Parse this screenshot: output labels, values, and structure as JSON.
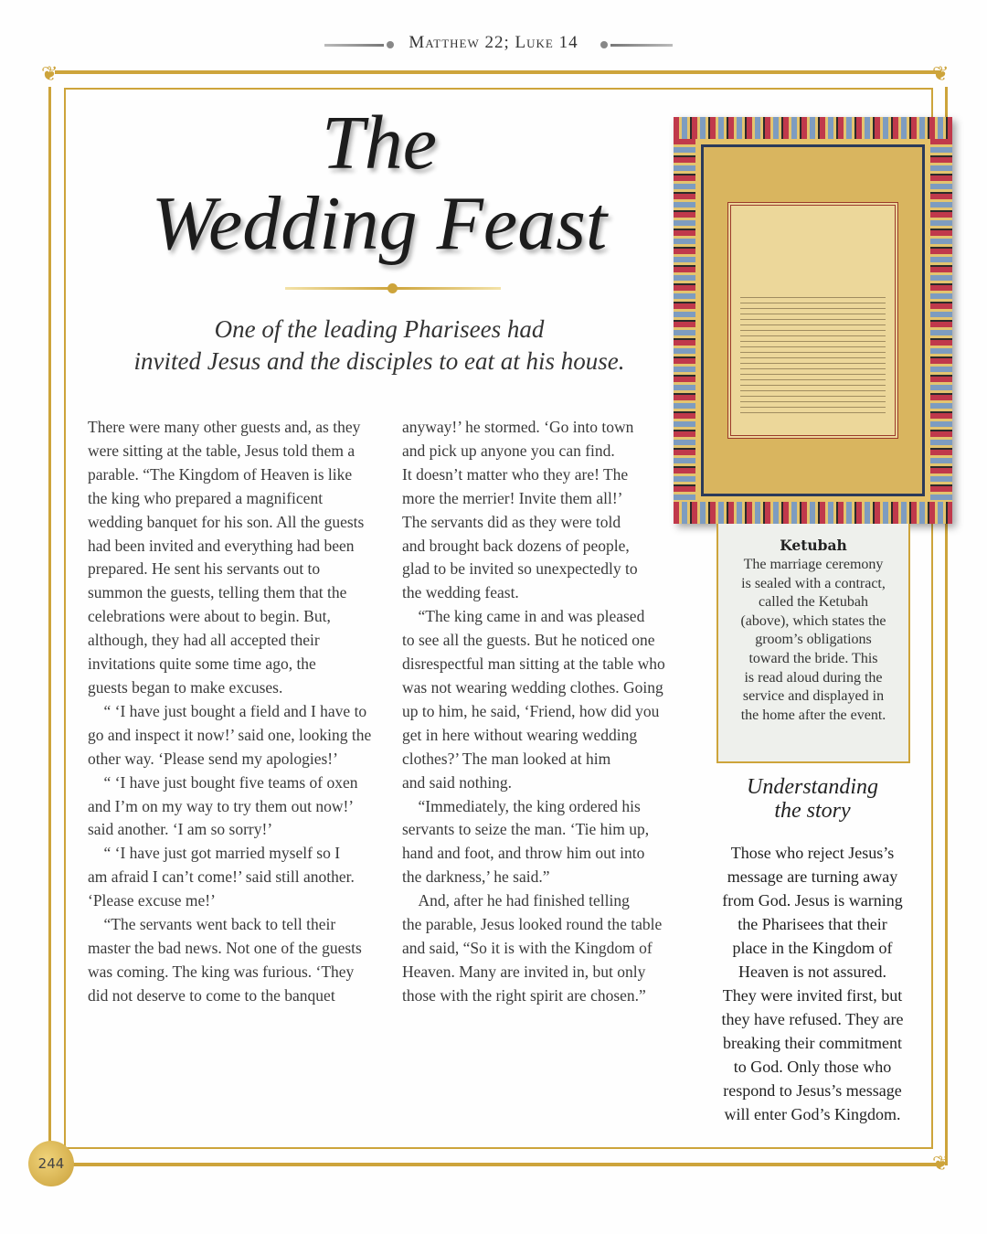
{
  "header": {
    "running_head": "Matthew 22; Luke 14"
  },
  "title": {
    "line1": "The",
    "line2": "Wedding Feast"
  },
  "intro": {
    "line1": "One of the leading Pharisees had",
    "line2": "invited Jesus and the disciples to eat at his house."
  },
  "story": {
    "col1": [
      "There were many other guests and, as they",
      "were sitting at the table, Jesus told them a",
      "parable. “The Kingdom of Heaven is like",
      "the king who prepared a magnificent",
      "wedding banquet for his son. All the guests",
      "had been invited and everything had been",
      "prepared. He sent his servants out to",
      "summon the guests, telling them that the",
      "celebrations were about to begin. But,",
      "although, they had all accepted their",
      "invitations quite some time ago, the",
      "guests began to make excuses.",
      "    “ ‘I have just bought a field and I have to",
      "go and inspect it now!’ said one, looking the",
      "other way. ‘Please send my apologies!’",
      "    “ ‘I have just bought five teams of oxen",
      "and I’m on my way to try them out now!’",
      "said another. ‘I am so sorry!’",
      "    “ ‘I have just got married myself so I",
      "am afraid I can’t come!’ said still another.",
      "‘Please excuse me!’",
      "    “The servants went back to tell their",
      "master the bad news. Not one of the guests",
      "was coming. The king was furious. ‘They",
      "did not deserve to come to the banquet"
    ],
    "col2": [
      "anyway!’ he stormed. ‘Go into town",
      "and pick up anyone you can find.",
      "It doesn’t matter who they are! The",
      "more the merrier! Invite them all!’",
      "The servants did as they were told",
      "and brought back dozens of people,",
      "glad to be invited so unexpectedly to",
      "the wedding feast.",
      "    “The king came in and was pleased",
      "to see all the guests. But he noticed one",
      "disrespectful man sitting at the table who",
      "was not wearing wedding clothes. Going",
      "up to him, he said, ‘Friend, how did you",
      "get in here without wearing wedding",
      "clothes?’ The man looked at him",
      "and said nothing.",
      "    “Immediately, the king ordered his",
      "servants to seize the man. ‘Tie him up,",
      "hand and foot, and throw him out into",
      "the darkness,’ he said.”",
      "    And, after he had finished telling",
      "the parable, Jesus looked round the table",
      "and said, “So it is with the Kingdom of",
      "Heaven. Many are invited in, but only",
      "those with the right spirit are chosen.”"
    ]
  },
  "caption": {
    "title": "Ketubah",
    "lines": [
      "The marriage ceremony",
      "is sealed with a contract,",
      "called the Ketubah",
      "(above), which states the",
      "groom’s obligations",
      "toward the bride. This",
      "is read aloud during the",
      "service and displayed in",
      "the home after the event."
    ]
  },
  "understanding": {
    "title1": "Understanding",
    "title2": "the story",
    "lines": [
      "Those who reject Jesus’s",
      "message are turning away",
      "from God. Jesus is warning",
      "the Pharisees that their",
      "place in the Kingdom of",
      "Heaven is not assured.",
      "They were invited first, but",
      "they have refused. They are",
      "breaking their commitment",
      "to God. Only those who",
      "respond to Jesus’s message",
      "will enter God’s Kingdom."
    ]
  },
  "page_number": "244",
  "colors": {
    "gold": "#cda43b",
    "caption_bg": "#eef0ec"
  }
}
